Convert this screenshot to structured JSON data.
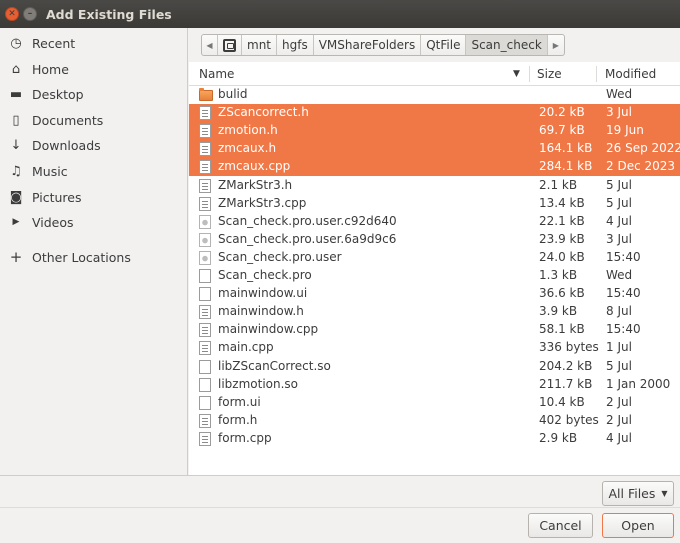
{
  "window": {
    "title": "Add Existing Files",
    "close_glyph": "✕",
    "min_glyph": "–"
  },
  "sidebar": {
    "items": [
      {
        "label": "Recent",
        "icon": "clock-icon",
        "glyph": "◷"
      },
      {
        "label": "Home",
        "icon": "home-icon",
        "glyph": "⌂"
      },
      {
        "label": "Desktop",
        "icon": "desktop-folder-icon",
        "glyph": "▬"
      },
      {
        "label": "Documents",
        "icon": "document-icon",
        "glyph": "▯"
      },
      {
        "label": "Downloads",
        "icon": "download-icon",
        "glyph": "↓"
      },
      {
        "label": "Music",
        "icon": "music-icon",
        "glyph": "♫"
      },
      {
        "label": "Pictures",
        "icon": "camera-icon",
        "glyph": "◙"
      },
      {
        "label": "Videos",
        "icon": "video-icon",
        "glyph": "▶"
      },
      {
        "label": "Other Locations",
        "icon": "plus-icon",
        "glyph": "+"
      }
    ]
  },
  "pathbar": {
    "left_arrow": "◀",
    "right_arrow": "▶",
    "segments": [
      "mnt",
      "hgfs",
      "VMShareFolders",
      "QtFile",
      "Scan_check"
    ],
    "active": "Scan_check"
  },
  "columns": {
    "name": "Name",
    "size": "Size",
    "modified": "Modified",
    "sort_indicator": "▼"
  },
  "files": [
    {
      "name": "bulid",
      "size": "",
      "modified": "Wed",
      "type": "folder",
      "selected": false
    },
    {
      "name": "ZScancorrect.h",
      "size": "20.2 kB",
      "modified": "3 Jul",
      "type": "text",
      "selected": true
    },
    {
      "name": "zmotion.h",
      "size": "69.7 kB",
      "modified": "19 Jun",
      "type": "text",
      "selected": true
    },
    {
      "name": "zmcaux.h",
      "size": "164.1 kB",
      "modified": "26 Sep 2022",
      "type": "text",
      "selected": true
    },
    {
      "name": "zmcaux.cpp",
      "size": "284.1 kB",
      "modified": "2 Dec 2023",
      "type": "text",
      "selected": true
    },
    {
      "name": "ZMarkStr3.h",
      "size": "2.1 kB",
      "modified": "5 Jul",
      "type": "text",
      "selected": false
    },
    {
      "name": "ZMarkStr3.cpp",
      "size": "13.4 kB",
      "modified": "5 Jul",
      "type": "text",
      "selected": false
    },
    {
      "name": "Scan_check.pro.user.c92d640",
      "size": "22.1 kB",
      "modified": "4 Jul",
      "type": "gear",
      "selected": false
    },
    {
      "name": "Scan_check.pro.user.6a9d9c6",
      "size": "23.9 kB",
      "modified": "3 Jul",
      "type": "gear",
      "selected": false
    },
    {
      "name": "Scan_check.pro.user",
      "size": "24.0 kB",
      "modified": "15:40",
      "type": "gear",
      "selected": false
    },
    {
      "name": "Scan_check.pro",
      "size": "1.3 kB",
      "modified": "Wed",
      "type": "blank",
      "selected": false
    },
    {
      "name": "mainwindow.ui",
      "size": "36.6 kB",
      "modified": "15:40",
      "type": "blank",
      "selected": false
    },
    {
      "name": "mainwindow.h",
      "size": "3.9 kB",
      "modified": "8 Jul",
      "type": "text",
      "selected": false
    },
    {
      "name": "mainwindow.cpp",
      "size": "58.1 kB",
      "modified": "15:40",
      "type": "text",
      "selected": false
    },
    {
      "name": "main.cpp",
      "size": "336 bytes",
      "modified": "1 Jul",
      "type": "text",
      "selected": false
    },
    {
      "name": "libZScanCorrect.so",
      "size": "204.2 kB",
      "modified": "5 Jul",
      "type": "blank",
      "selected": false
    },
    {
      "name": "libzmotion.so",
      "size": "211.7 kB",
      "modified": "1 Jan 2000",
      "type": "blank",
      "selected": false
    },
    {
      "name": "form.ui",
      "size": "10.4 kB",
      "modified": "2 Jul",
      "type": "blank",
      "selected": false
    },
    {
      "name": "form.h",
      "size": "402 bytes",
      "modified": "2 Jul",
      "type": "text",
      "selected": false
    },
    {
      "name": "form.cpp",
      "size": "2.9 kB",
      "modified": "4 Jul",
      "type": "text",
      "selected": false
    }
  ],
  "footer": {
    "filter_label": "All Files",
    "filter_arrow": "▼",
    "cancel_label": "Cancel",
    "open_label": "Open"
  },
  "colors": {
    "selection": "#f07746",
    "titlebar": "#3b3a37",
    "folder": "#e8813a"
  }
}
